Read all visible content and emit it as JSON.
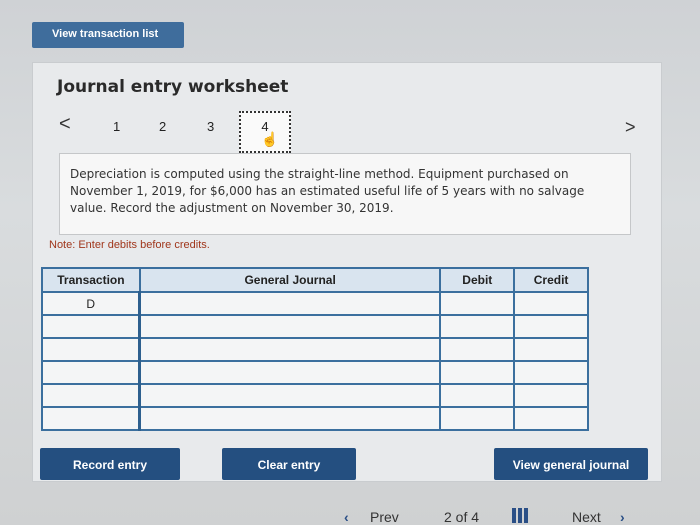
{
  "top_button": "View transaction list",
  "title": "Journal entry worksheet",
  "pagination": {
    "prev_symbol": "<",
    "next_symbol": ">",
    "pages": [
      "1",
      "2",
      "3",
      "4"
    ],
    "current": "4"
  },
  "description": "Depreciation is computed using the straight-line method. Equipment purchased on November 1, 2019, for $6,000 has an estimated useful life of 5 years with no salvage value. Record the adjustment on November 30, 2019.",
  "note": "Note: Enter debits before credits.",
  "table": {
    "headers": [
      "Transaction",
      "General Journal",
      "Debit",
      "Credit"
    ],
    "rows": [
      [
        "D",
        "",
        "",
        ""
      ],
      [
        "",
        "",
        "",
        ""
      ],
      [
        "",
        "",
        "",
        ""
      ],
      [
        "",
        "",
        "",
        ""
      ],
      [
        "",
        "",
        "",
        ""
      ],
      [
        "",
        "",
        "",
        ""
      ]
    ]
  },
  "buttons": {
    "record": "Record entry",
    "clear": "Clear entry",
    "view_general": "View general journal"
  },
  "footer": {
    "prev": "Prev",
    "page_status": "2 of 4",
    "next": "Next"
  },
  "colors": {
    "accent": "#244f80",
    "table_border": "#3b6f9e",
    "note": "#a0361b"
  }
}
